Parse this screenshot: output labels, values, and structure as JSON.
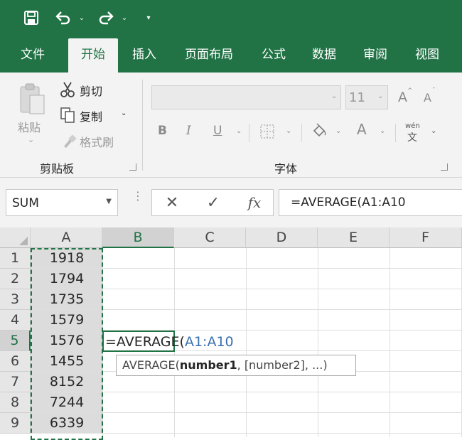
{
  "qat": {
    "save_icon": "save-icon",
    "undo_icon": "undo-icon",
    "redo_icon": "redo-icon",
    "dropdown_glyph": "⌄",
    "customize_glyph": "▾"
  },
  "tabs": [
    {
      "label": "文件"
    },
    {
      "label": "开始",
      "active": true
    },
    {
      "label": "插入"
    },
    {
      "label": "页面布局"
    },
    {
      "label": "公式"
    },
    {
      "label": "数据"
    },
    {
      "label": "审阅"
    },
    {
      "label": "视图"
    }
  ],
  "ribbon": {
    "clipboard": {
      "paste_label": "粘贴",
      "cut_label": "剪切",
      "copy_label": "复制",
      "format_painter_label": "格式刷",
      "group_label": "剪贴板"
    },
    "font": {
      "font_name": "",
      "font_size": "11",
      "bold_label": "B",
      "italic_label": "I",
      "underline_label": "U",
      "increase_size_label": "A",
      "decrease_size_label": "A",
      "font_color_label": "A",
      "phonetic_top": "wén",
      "phonetic_bottom": "文",
      "group_label": "字体"
    }
  },
  "formula_bar": {
    "name_box": "SUM",
    "cancel_glyph": "✕",
    "enter_glyph": "✓",
    "fx_label": "fx",
    "formula": "=AVERAGE(A1:A10"
  },
  "sheet": {
    "columns": [
      "A",
      "B",
      "C",
      "D",
      "E",
      "F"
    ],
    "rows": [
      "1",
      "2",
      "3",
      "4",
      "5",
      "6",
      "7",
      "8",
      "9"
    ],
    "column_a_values": [
      "1918",
      "1794",
      "1735",
      "1579",
      "1576",
      "1455",
      "8152",
      "7244",
      "6339"
    ],
    "editing_cell": {
      "prefix": "=AVERAGE(",
      "reference": "A1:A10"
    },
    "tooltip": {
      "func": "AVERAGE(",
      "arg1": "number1",
      "rest": ", [number2], ...)"
    }
  },
  "colors": {
    "accent": "#217346",
    "ribbon_bg": "#f3f3f3",
    "reference_blue": "#3a6fb0"
  }
}
